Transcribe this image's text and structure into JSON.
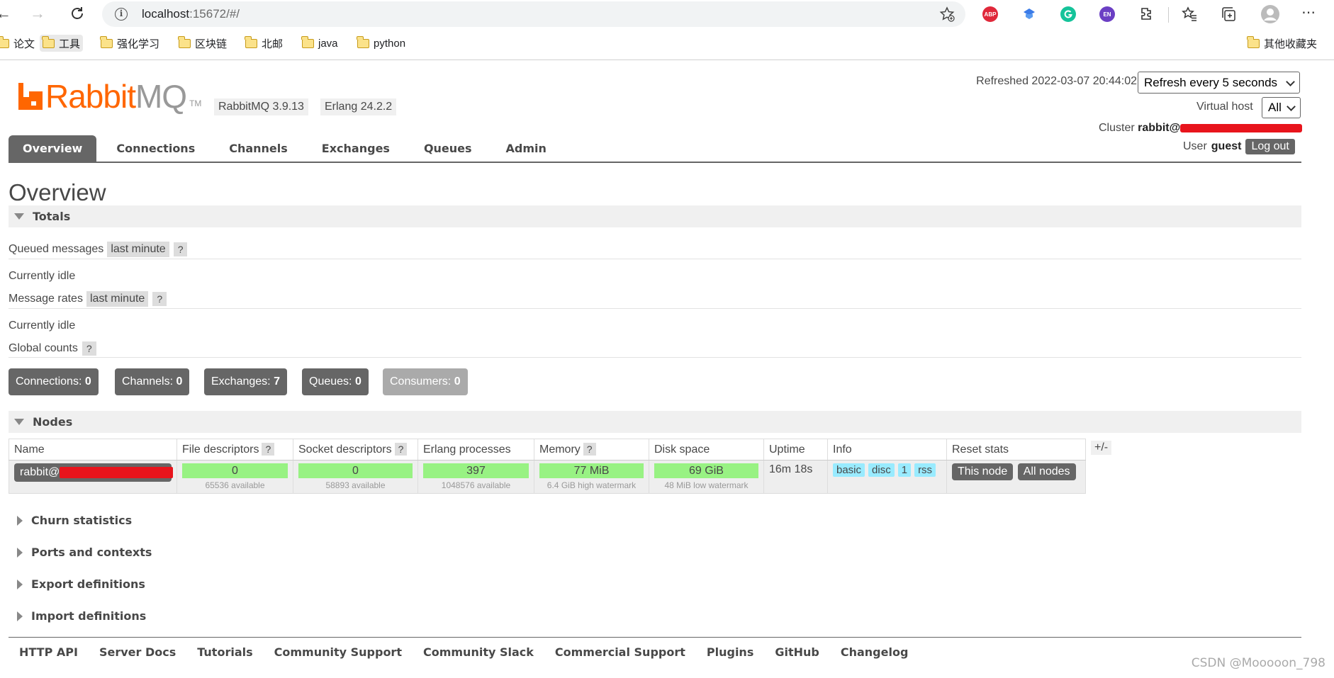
{
  "browser": {
    "url_host": "localhost",
    "url_rest": ":15672/#/",
    "extensions": {
      "abp_label": "ABP",
      "en_label": "EN"
    },
    "bookmarks": [
      {
        "label": "论文"
      },
      {
        "label": "工具"
      },
      {
        "label": "强化学习"
      },
      {
        "label": "区块链"
      },
      {
        "label": "北邮"
      },
      {
        "label": "java"
      },
      {
        "label": "python"
      }
    ],
    "other_bookmarks": "其他收藏夹"
  },
  "header": {
    "logo_rabbit": "Rabbit",
    "logo_mq": "MQ",
    "logo_tm": "TM",
    "rabbitmq_version": "RabbitMQ 3.9.13",
    "erlang_version": "Erlang 24.2.2",
    "refreshed": "Refreshed 2022-03-07 20:44:02",
    "refresh_select": "Refresh every 5 seconds",
    "vhost_label": "Virtual host",
    "vhost_value": "All",
    "cluster_label": "Cluster",
    "cluster_value": "rabbit@",
    "user_label": "User",
    "user_value": "guest",
    "logout": "Log out"
  },
  "tabs": [
    "Overview",
    "Connections",
    "Channels",
    "Exchanges",
    "Queues",
    "Admin"
  ],
  "page_title": "Overview",
  "totals": {
    "title": "Totals",
    "queued_messages": "Queued messages",
    "message_rates": "Message rates",
    "global_counts": "Global counts",
    "range": "last minute",
    "help": "?",
    "idle": "Currently idle"
  },
  "counts": [
    {
      "label": "Connections:",
      "value": "0"
    },
    {
      "label": "Channels:",
      "value": "0"
    },
    {
      "label": "Exchanges:",
      "value": "7"
    },
    {
      "label": "Queues:",
      "value": "0"
    },
    {
      "label": "Consumers:",
      "value": "0"
    }
  ],
  "nodes": {
    "title": "Nodes",
    "headers": [
      "Name",
      "File descriptors",
      "Socket descriptors",
      "Erlang processes",
      "Memory",
      "Disk space",
      "Uptime",
      "Info",
      "Reset stats"
    ],
    "row": {
      "name": "rabbit@",
      "file_descriptors": "0",
      "file_descriptors_sub": "65536 available",
      "socket_descriptors": "0",
      "socket_descriptors_sub": "58893 available",
      "erlang_processes": "397",
      "erlang_processes_sub": "1048576 available",
      "memory": "77 MiB",
      "memory_sub": "6.4 GiB high watermark",
      "disk_space": "69 GiB",
      "disk_space_sub": "48 MiB low watermark",
      "uptime": "16m 18s",
      "info_tags": [
        "basic",
        "disc",
        "1",
        "rss"
      ],
      "reset_this_node": "This node",
      "reset_all_nodes": "All nodes"
    },
    "columns_toggle": "+/-"
  },
  "collapsed_sections": [
    "Churn statistics",
    "Ports and contexts",
    "Export definitions",
    "Import definitions"
  ],
  "footer": [
    "HTTP API",
    "Server Docs",
    "Tutorials",
    "Community Support",
    "Community Slack",
    "Commercial Support",
    "Plugins",
    "GitHub",
    "Changelog"
  ],
  "watermark": "CSDN @Mooooon_798",
  "colors": {
    "brand_orange": "#ff6600",
    "tab_active": "#666666",
    "bar_green": "#98f283",
    "info_tag": "#99ebff",
    "redaction": "#e8141c"
  }
}
